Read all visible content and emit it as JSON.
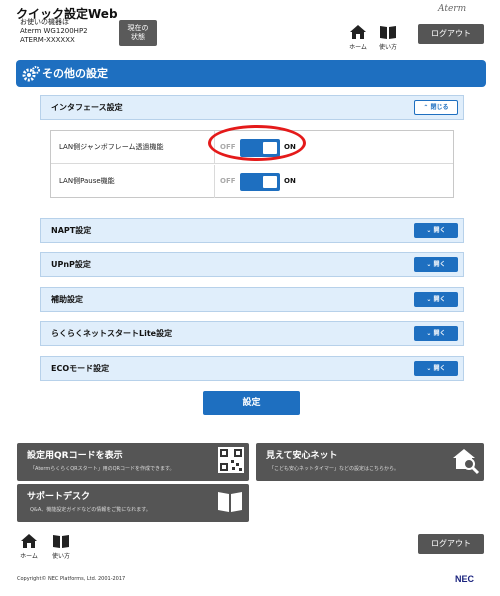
{
  "header": {
    "app_title": "クイック設定Web",
    "device_label": "お使いの機器は",
    "device_model": "Aterm WG1200HP2",
    "device_id": "ATERM-XXXXXX",
    "status_button_line1": "現在の",
    "status_button_line2": "状態",
    "brand": "Aterm",
    "home_label": "ホーム",
    "help_label": "使い方",
    "logout_label": "ログアウト"
  },
  "section": {
    "title": "その他の設定"
  },
  "interface_panel": {
    "title": "インタフェース設定",
    "close_label": "閉じる",
    "rows": [
      {
        "label": "LAN側ジャンボフレーム透過機能",
        "off": "OFF",
        "on": "ON"
      },
      {
        "label": "LAN側Pause機能",
        "off": "OFF",
        "on": "ON"
      }
    ]
  },
  "collapsed_panels": [
    {
      "title": "NAPT設定",
      "open_label": "開く"
    },
    {
      "title": "UPnP設定",
      "open_label": "開く"
    },
    {
      "title": "補助設定",
      "open_label": "開く"
    },
    {
      "title": "らくらくネットスタートLite設定",
      "open_label": "開く"
    },
    {
      "title": "ECOモード設定",
      "open_label": "開く"
    }
  ],
  "submit_label": "設定",
  "cards": {
    "qr": {
      "title": "設定用QRコードを表示",
      "desc": "「AtermらくらくQRスタート」用のQRコードを作成できます。"
    },
    "safety": {
      "title": "見えて安心ネット",
      "desc": "「こども安心ネットタイマー」などの設定はこちらから。"
    },
    "support": {
      "title": "サポートデスク",
      "desc": "Q&A、機能設定ガイドなどの情報をご覧になれます。"
    }
  },
  "footer": {
    "home_label": "ホーム",
    "help_label": "使い方",
    "logout_label": "ログアウト",
    "copyright": "Copyright© NEC Platforms, Ltd. 2001-2017",
    "nec": "NEC"
  },
  "colors": {
    "accent": "#1e6fc0",
    "panel_bg": "#e0eefb",
    "dark_button": "#555555",
    "highlight": "#e41a1a"
  }
}
